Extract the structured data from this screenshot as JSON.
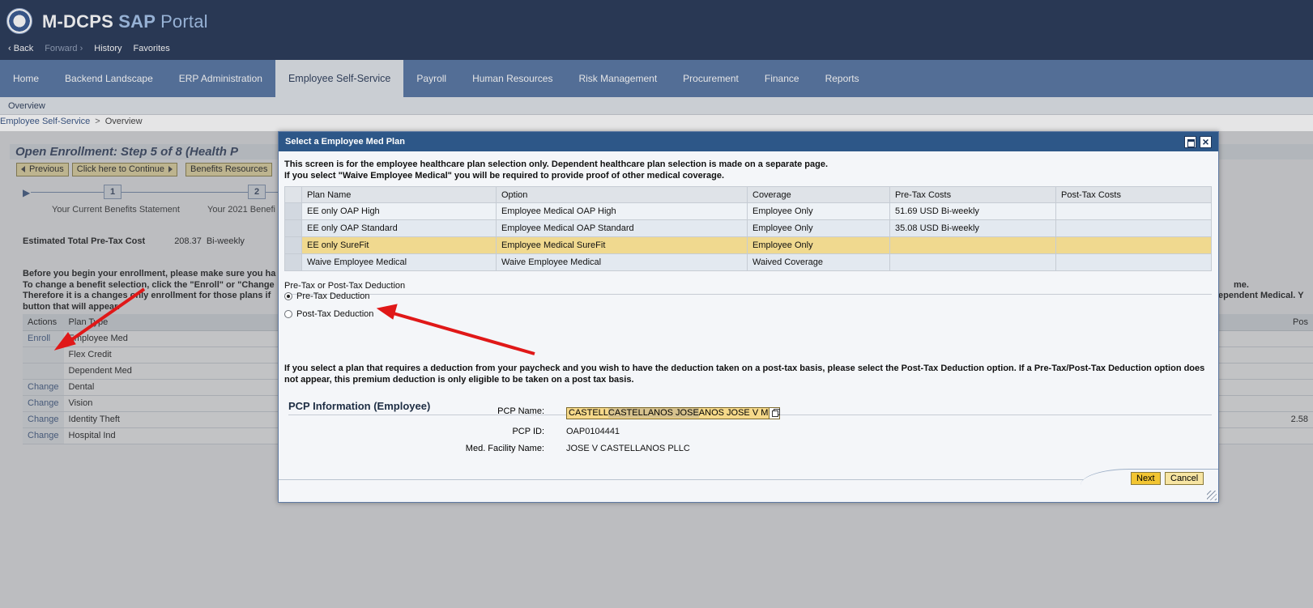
{
  "header": {
    "title_main": "M-DCPS",
    "title_sap": "SAP",
    "title_portal": "Portal",
    "history": {
      "back": "Back",
      "forward": "Forward",
      "history": "History",
      "favorites": "Favorites"
    }
  },
  "topnav": {
    "tabs": [
      "Home",
      "Backend Landscape",
      "ERP Administration",
      "Employee Self-Service",
      "Payroll",
      "Human Resources",
      "Risk Management",
      "Procurement",
      "Finance",
      "Reports"
    ],
    "active": "Employee Self-Service"
  },
  "subnav": {
    "item": "Overview"
  },
  "breadcrumb": {
    "root": "Employee Self-Service",
    "separator": ">",
    "current": "Overview"
  },
  "background": {
    "step_title": "Open Enrollment: Step 5  of 8  (Health P",
    "toolbar": {
      "previous": "Previous",
      "continue": "Click here to Continue",
      "resources": "Benefits Resources"
    },
    "roadmap": [
      {
        "num": "1",
        "label": "Your Current Benefits Statement"
      },
      {
        "num": "2",
        "label": "Your 2021 Benefi"
      }
    ],
    "estimated": {
      "label": "Estimated Total Pre-Tax Cost",
      "value": "208.37",
      "period": "Bi-weekly"
    },
    "instructions": [
      "Before you begin your enrollment, please make sure you ha",
      "To change a benefit selection, click the \"Enroll\" or \"Change",
      "Therefore it is a changes only enrollment for those plans if",
      "button that will appear."
    ],
    "instructions_right": [
      "me.",
      "/Dependent Medical. Y"
    ],
    "table": {
      "headers": {
        "actions": "Actions",
        "plan_type": "Plan Type",
        "far": "Pos"
      },
      "rows": [
        {
          "action": "Enroll",
          "plan": "Employee Med",
          "far": ""
        },
        {
          "action": "",
          "plan": "Flex Credit",
          "far": ""
        },
        {
          "action": "",
          "plan": "Dependent Med",
          "far": ""
        },
        {
          "action": "Change",
          "plan": "Dental",
          "far": ""
        },
        {
          "action": "Change",
          "plan": "Vision",
          "far": ""
        },
        {
          "action": "Change",
          "plan": "Identity Theft",
          "far": "2.58"
        },
        {
          "action": "Change",
          "plan": "Hospital Ind",
          "far": ""
        }
      ]
    }
  },
  "dialog": {
    "title": "Select a Employee Med Plan",
    "intro": [
      "This screen is for the employee healthcare plan selection only. Dependent healthcare plan selection is made on a separate page.",
      "If you select \"Waive Employee Medical\" you will be required to provide proof of other medical coverage."
    ],
    "table": {
      "headers": [
        "Plan Name",
        "Option",
        "Coverage",
        "Pre-Tax Costs",
        "Post-Tax Costs"
      ],
      "rows": [
        {
          "plan": "EE only OAP High",
          "option": "Employee Medical OAP High",
          "coverage": "Employee Only",
          "pretax": "51.69 USD Bi-weekly",
          "posttax": "",
          "selected": false
        },
        {
          "plan": "EE only OAP Standard",
          "option": "Employee Medical OAP Standard",
          "coverage": "Employee Only",
          "pretax": "35.08 USD Bi-weekly",
          "posttax": "",
          "selected": false
        },
        {
          "plan": "EE only SureFit",
          "option": "Employee Medical SureFit",
          "coverage": "Employee Only",
          "pretax": "",
          "posttax": "",
          "selected": true
        },
        {
          "plan": "Waive Employee Medical",
          "option": "Waive Employee Medical",
          "coverage": "Waived Coverage",
          "pretax": "",
          "posttax": "",
          "selected": false
        }
      ]
    },
    "deduction": {
      "title": "Pre-Tax or Post-Tax Deduction",
      "pre": "Pre-Tax Deduction",
      "post": "Post-Tax Deduction",
      "selected": "pre",
      "note": "If you select a plan that requires a deduction from your paycheck and you wish to have the deduction taken on a post-tax basis, please select the Post-Tax Deduction option. If a Pre-Tax/Post-Tax Deduction option does not appear, this premium deduction is only eligible to be taken on a post tax basis."
    },
    "pcp": {
      "title": "PCP Information (Employee)",
      "name_label": "PCP Name:",
      "name_value_a": "CASTELL",
      "name_value_hl": "CASTELLANOS JOSE",
      "name_value_b": "ANOS JOSE V   MD",
      "id_label": "PCP ID:",
      "id_value": "OAP0104441",
      "facility_label": "Med. Facility Name:",
      "facility_value": "JOSE V CASTELLANOS PLLC"
    },
    "buttons": {
      "next": "Next",
      "cancel": "Cancel"
    }
  },
  "colors": {
    "header": "#1a2c4e",
    "nav": "#4d6e9e",
    "dialog_title": "#2d5788",
    "selected_row": "#f0d98f",
    "annotation": "#e01818"
  }
}
